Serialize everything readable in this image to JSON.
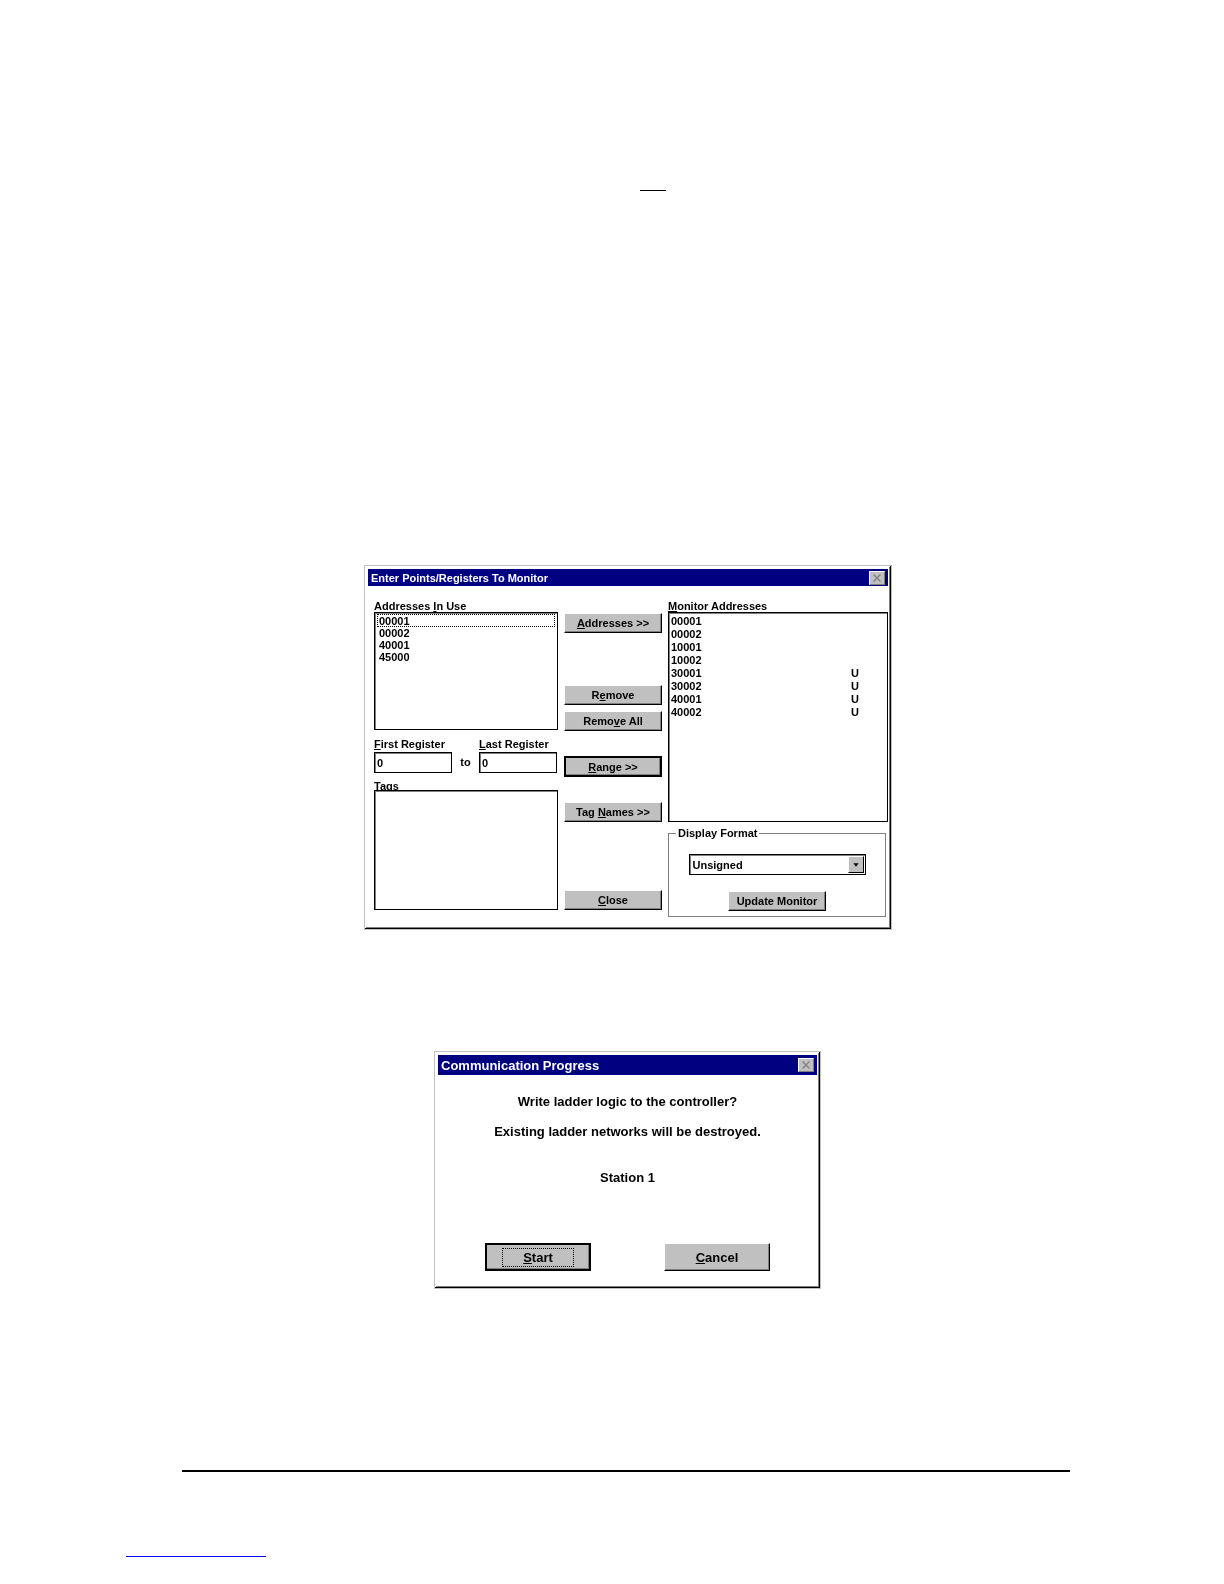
{
  "monitor_dialog": {
    "title": "Enter Points/Registers To Monitor",
    "addresses_in_use": {
      "label": {
        "before": "Addresses ",
        "key": "I",
        "after": "n Use"
      },
      "items": [
        {
          "text": "00001",
          "selected": true
        },
        {
          "text": "00002",
          "selected": false
        },
        {
          "text": "40001",
          "selected": false
        },
        {
          "text": "45000",
          "selected": false
        }
      ]
    },
    "first_register": {
      "label": {
        "key": "F",
        "after": "irst Register"
      },
      "value": "0"
    },
    "to_label": "to",
    "last_register": {
      "label": {
        "key": "L",
        "after": "ast Register"
      },
      "value": "0"
    },
    "tags": {
      "label": {
        "key": "T",
        "after": "ags"
      }
    },
    "buttons": [
      {
        "label": {
          "key": "A",
          "after": "ddresses >>"
        },
        "default": false
      },
      {
        "label": {
          "before": "R",
          "key": "e",
          "after": "move"
        },
        "default": false
      },
      {
        "label": {
          "before": "Remo",
          "key": "v",
          "after": "e All"
        },
        "default": false
      },
      {
        "label": {
          "key": "R",
          "after": "ange >>"
        },
        "default": true
      },
      {
        "label": {
          "before": "Tag ",
          "key": "N",
          "after": "ames >>"
        },
        "default": false
      },
      {
        "label": {
          "key": "C",
          "after": "lose"
        },
        "default": false
      }
    ],
    "monitor_addresses": {
      "label": {
        "key": "M",
        "after": "onitor Addresses"
      },
      "rows": [
        {
          "address": "00001"
        },
        {
          "address": "00002"
        },
        {
          "address": "10001"
        },
        {
          "address": "10002"
        },
        {
          "address": "30001",
          "column_2": "U"
        },
        {
          "address": "30002",
          "column_2": "U"
        },
        {
          "address": "40001",
          "column_2": "U"
        },
        {
          "address": "40002",
          "column_2": "U"
        }
      ]
    },
    "display_format": {
      "title": "Display Format",
      "value": "Unsigned",
      "button": "Update Monitor"
    }
  },
  "communication_dialog": {
    "title": "Communication Progress",
    "lines": [
      "Write ladder logic to the controller?",
      "Existing ladder networks will be destroyed."
    ],
    "station": "Station 1",
    "buttons": [
      {
        "label": {
          "key": "S",
          "after": "tart"
        },
        "default": true
      },
      {
        "label": {
          "key": "C",
          "after": "ancel"
        },
        "default": false
      }
    ]
  }
}
